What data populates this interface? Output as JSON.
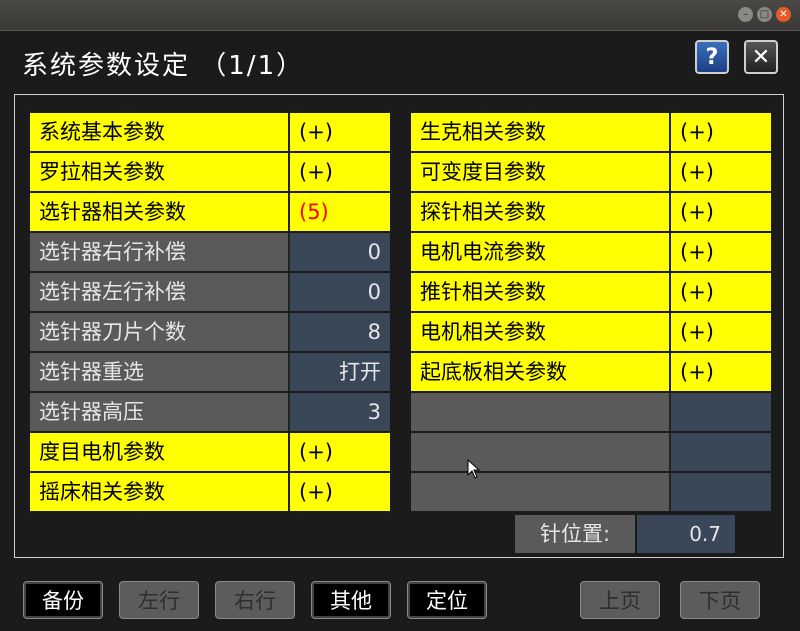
{
  "window": {
    "controls": [
      "minimize",
      "maximize",
      "close"
    ]
  },
  "header": {
    "title": "系统参数设定 （1/1）",
    "help_icon": "?",
    "close_icon": "✕"
  },
  "left": [
    {
      "label": "系统基本参数",
      "value": "(+)",
      "style": "yellow"
    },
    {
      "label": "罗拉相关参数",
      "value": "(+)",
      "style": "yellow"
    },
    {
      "label": "选针器相关参数",
      "value": "(5)",
      "style": "yellow-red"
    },
    {
      "label": "选针器右行补偿",
      "value": "0",
      "style": "gray"
    },
    {
      "label": "选针器左行补偿",
      "value": "0",
      "style": "gray"
    },
    {
      "label": "选针器刀片个数",
      "value": "8",
      "style": "gray"
    },
    {
      "label": "选针器重选",
      "value": "打开",
      "style": "gray"
    },
    {
      "label": "选针器高压",
      "value": "3",
      "style": "gray"
    },
    {
      "label": "度目电机参数",
      "value": "(+)",
      "style": "yellow"
    },
    {
      "label": "摇床相关参数",
      "value": "(+)",
      "style": "yellow"
    }
  ],
  "right": [
    {
      "label": "生克相关参数",
      "value": "(+)",
      "style": "yellow"
    },
    {
      "label": "可变度目参数",
      "value": "(+)",
      "style": "yellow"
    },
    {
      "label": "探针相关参数",
      "value": "(+)",
      "style": "yellow"
    },
    {
      "label": "电机电流参数",
      "value": "(+)",
      "style": "yellow"
    },
    {
      "label": "推针相关参数",
      "value": "(+)",
      "style": "yellow"
    },
    {
      "label": "电机相关参数",
      "value": "(+)",
      "style": "yellow"
    },
    {
      "label": "起底板相关参数",
      "value": "(+)",
      "style": "yellow"
    },
    {
      "label": "",
      "value": "",
      "style": "empty"
    },
    {
      "label": "",
      "value": "",
      "style": "empty"
    },
    {
      "label": "",
      "value": "",
      "style": "empty"
    }
  ],
  "needle_position": {
    "label": "针位置:",
    "value": "0.7"
  },
  "buttons": {
    "backup": "备份",
    "move_left": "左行",
    "move_right": "右行",
    "other": "其他",
    "locate": "定位",
    "page_up": "上页",
    "page_down": "下页"
  },
  "colors": {
    "highlight": "#ffff00",
    "row_gray": "#5a5a5a",
    "value_blue": "#3a4758",
    "alert": "#ff0000"
  }
}
